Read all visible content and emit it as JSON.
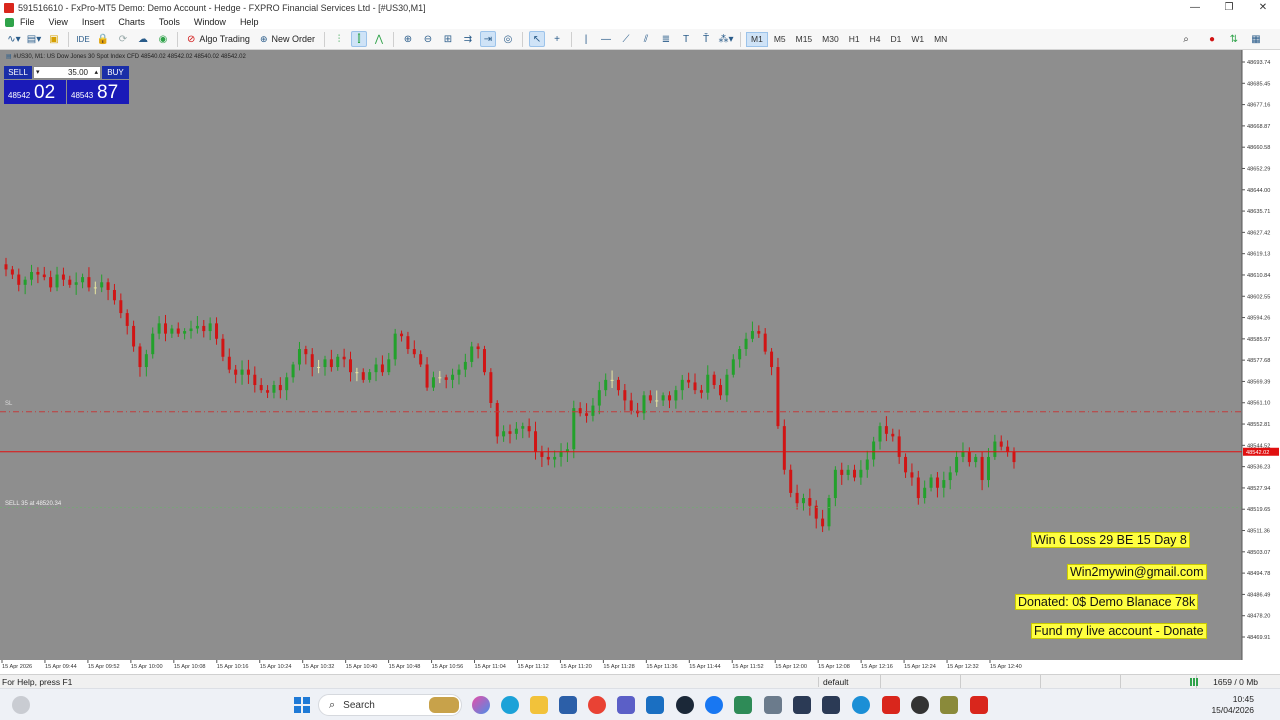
{
  "window": {
    "title": "591516610 - FxPro-MT5 Demo: Demo Account - Hedge - FXPRO Financial Services Ltd - [#US30,M1]",
    "controls": [
      "—",
      "❐",
      "✕"
    ]
  },
  "menu": [
    "File",
    "View",
    "Insert",
    "Charts",
    "Tools",
    "Window",
    "Help"
  ],
  "toolbar": {
    "algo_trading": "Algo Trading",
    "new_order": "New Order",
    "timeframes": [
      "M1",
      "M5",
      "M15",
      "M30",
      "H1",
      "H4",
      "D1",
      "W1",
      "MN"
    ],
    "active_timeframe": "M1"
  },
  "chart": {
    "header": "#US30, M1: US Dow Jones 30 Spot Index CFD  48540.02 48542.02 48540.02 48542.02",
    "sell_label": "SELL",
    "buy_label": "BUY",
    "volume": "35.00",
    "sell_price_small": "48542",
    "sell_price_big": "02",
    "buy_price_small": "48543",
    "buy_price_big": "87",
    "sl_label": "SL",
    "order_label": "SELL 35 at 48520.34",
    "current_price_tag": "48542.02",
    "info_boxes": [
      "Win 6  Loss 29  BE 15  Day 8",
      "Win2mywin@gmail.com",
      "Donated: 0$  Demo Blanace 78k",
      "Fund my live account - Donate"
    ],
    "colors": {
      "background": "#ffffff",
      "bull": "#22a12b",
      "bear": "#d11414",
      "doji": "#e8e6a0",
      "bid_line": "#e01010",
      "sl_line": "#c23b3b",
      "label_box": "#ffff40"
    }
  },
  "chart_data": {
    "type": "candlestick",
    "symbol": "#US30",
    "timeframe": "M1",
    "y_ticks": [
      "48693.74",
      "48685.45",
      "48677.16",
      "48668.87",
      "48660.58",
      "48652.29",
      "48644.00",
      "48635.71",
      "48627.42",
      "48619.13",
      "48610.84",
      "48602.55",
      "48594.26",
      "48585.97",
      "48577.68",
      "48569.39",
      "48561.10",
      "48552.81",
      "48544.52",
      "48536.23",
      "48527.94",
      "48519.65",
      "48511.36",
      "48503.07",
      "48494.78",
      "48486.49",
      "48478.20",
      "48469.91"
    ],
    "x_ticks": [
      "15 Apr 2026",
      "15 Apr 09:44",
      "15 Apr 09:52",
      "15 Apr 10:00",
      "15 Apr 10:08",
      "15 Apr 10:16",
      "15 Apr 10:24",
      "15 Apr 10:32",
      "15 Apr 10:40",
      "15 Apr 10:48",
      "15 Apr 10:56",
      "15 Apr 11:04",
      "15 Apr 11:12",
      "15 Apr 11:20",
      "15 Apr 11:28",
      "15 Apr 11:36",
      "15 Apr 11:44",
      "15 Apr 11:52",
      "15 Apr 12:00",
      "15 Apr 12:08",
      "15 Apr 12:16",
      "15 Apr 12:24",
      "15 Apr 12:32",
      "15 Apr 12:40"
    ],
    "bid_price": 48542.02,
    "sl_price": 48557.6,
    "order_price": 48520.34,
    "ylim": [
      48465,
      48698
    ],
    "close_path": [
      48613,
      48611,
      48607,
      48609,
      48612,
      48611,
      48610,
      48606,
      48611,
      48609,
      48607,
      48608,
      48610,
      48606,
      48606,
      48608,
      48605,
      48601,
      48596,
      48591,
      48583,
      48575,
      48580,
      48588,
      48592,
      48588,
      48590,
      48588,
      48589,
      48590,
      48591,
      48589,
      48592,
      48586,
      48579,
      48574,
      48572,
      48574,
      48572,
      48568,
      48566,
      48565,
      48568,
      48566,
      48571,
      48576,
      48582,
      48580,
      48575,
      48575,
      48578,
      48575,
      48579,
      48578,
      48573,
      48573,
      48570,
      48573,
      48576,
      48573,
      48578,
      48588,
      48587,
      48582,
      48580,
      48576,
      48567,
      48571,
      48571,
      48570,
      48572,
      48574,
      48577,
      48583,
      48582,
      48573,
      48561,
      48548,
      48550,
      48549,
      48551,
      48552,
      48550,
      48542,
      48540,
      48539,
      48540,
      48542,
      48543,
      48559,
      48557,
      48556,
      48560,
      48566,
      48570,
      48570,
      48566,
      48562,
      48558,
      48557,
      48564,
      48562,
      48562,
      48564,
      48562,
      48566,
      48570,
      48569,
      48566,
      48565,
      48572,
      48568,
      48564,
      48572,
      48578,
      48582,
      48586,
      48589,
      48588,
      48581,
      48575,
      48552,
      48535,
      48526,
      48522,
      48524,
      48521,
      48516,
      48513,
      48524,
      48535,
      48533,
      48535,
      48532,
      48535,
      48539,
      48546,
      48552,
      48549,
      48548,
      48540,
      48534,
      48532,
      48524,
      48528,
      48532,
      48528,
      48531,
      48534,
      48540,
      48542,
      48538,
      48540,
      48531,
      48540,
      48546,
      48544,
      48542,
      48538
    ]
  },
  "status": {
    "help": "For Help, press F1",
    "profile": "default",
    "traffic": "1659 / 0 Mb"
  },
  "taskbar": {
    "search": "Search",
    "time": "10:45",
    "date": "15/04/2026"
  }
}
